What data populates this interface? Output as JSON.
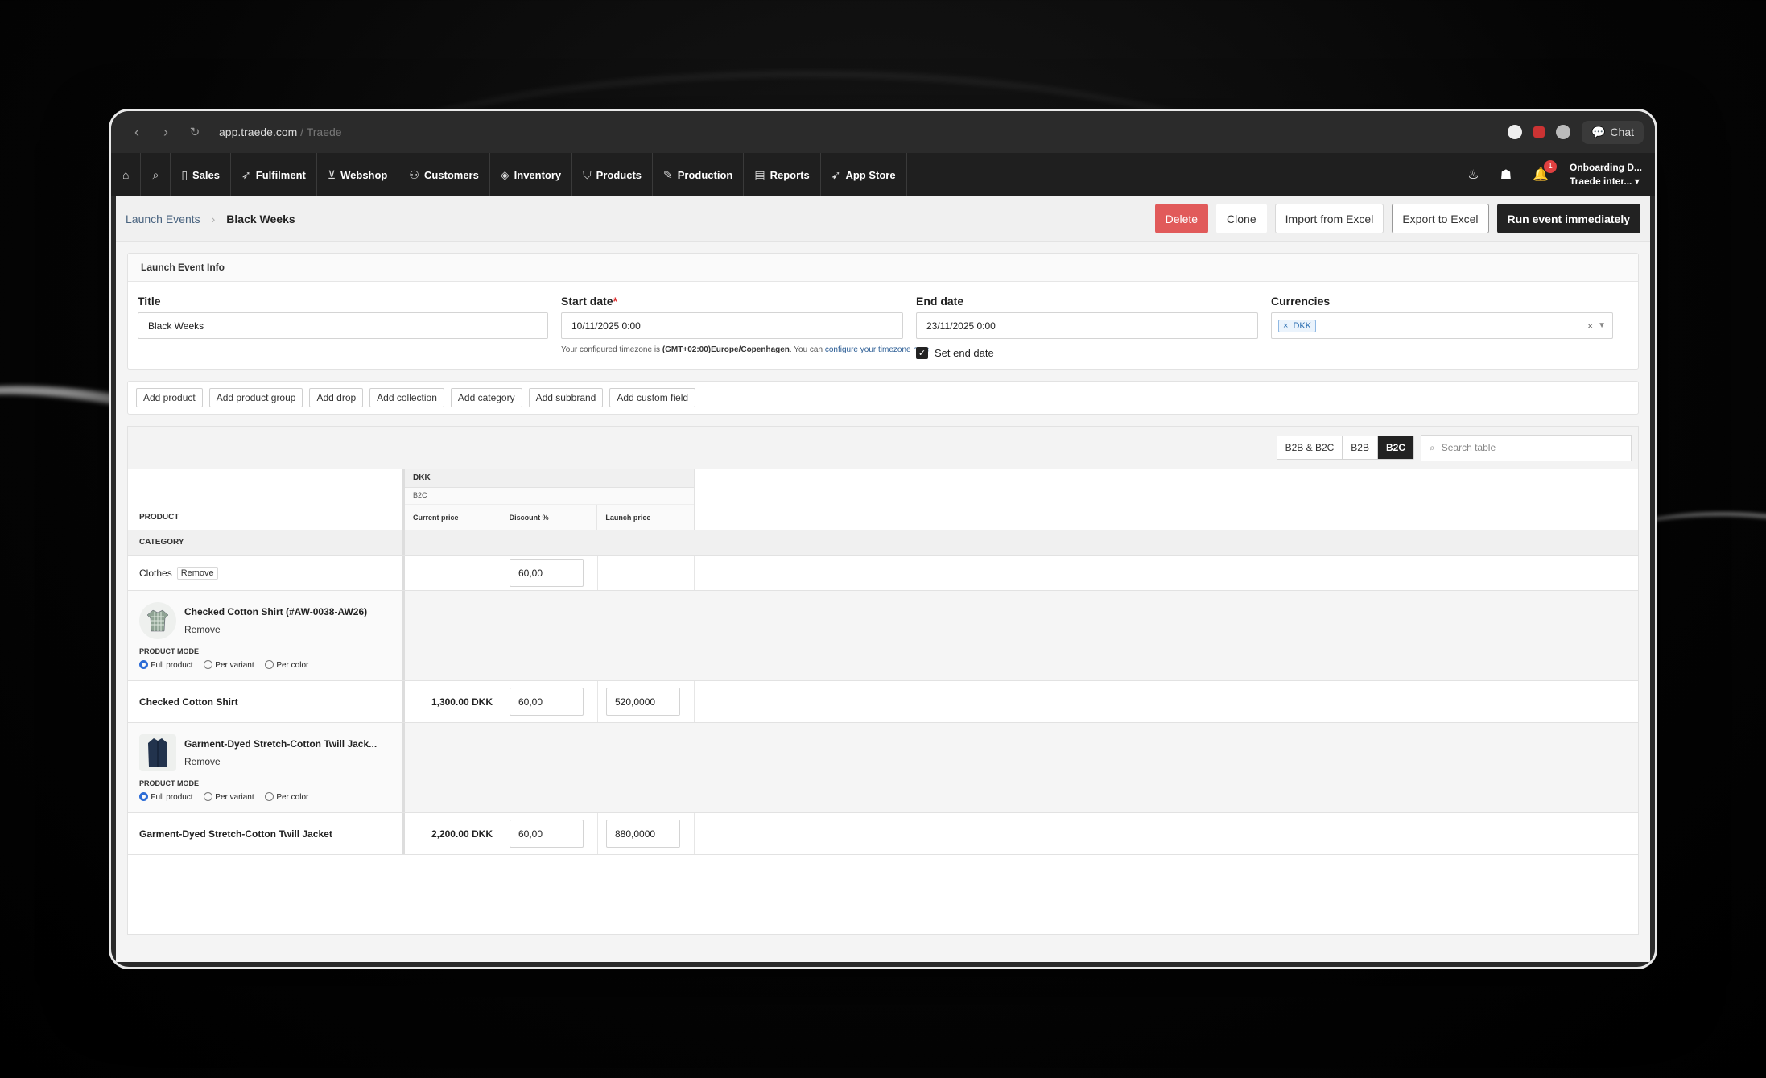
{
  "browser": {
    "url_host": "app.traede.com",
    "url_suffix": " / Traede",
    "chat_label": "Chat"
  },
  "nav": {
    "items": [
      {
        "label": "Sales",
        "icon": "document-icon"
      },
      {
        "label": "Fulfilment",
        "icon": "send-icon"
      },
      {
        "label": "Webshop",
        "icon": "cart-icon"
      },
      {
        "label": "Customers",
        "icon": "users-icon"
      },
      {
        "label": "Inventory",
        "icon": "box-icon"
      },
      {
        "label": "Products",
        "icon": "shirt-icon"
      },
      {
        "label": "Production",
        "icon": "pencil-icon"
      },
      {
        "label": "Reports",
        "icon": "chart-icon"
      },
      {
        "label": "App Store",
        "icon": "rocket-icon"
      }
    ],
    "notification_count": "1",
    "user_line1": "Onboarding D...",
    "user_line2": "Traede inter..."
  },
  "header": {
    "breadcrumb_parent": "Launch Events",
    "breadcrumb_current": "Black Weeks",
    "delete": "Delete",
    "clone": "Clone",
    "import": "Import from Excel",
    "export": "Export to Excel",
    "run": "Run event immediately"
  },
  "info": {
    "card_title": "Launch Event Info",
    "title_label": "Title",
    "title_value": "Black Weeks",
    "start_label": "Start date",
    "start_required": "*",
    "start_value": "10/11/2025 0:00",
    "end_label": "End date",
    "end_value": "23/11/2025 0:00",
    "set_end_label": "Set end date",
    "currencies_label": "Currencies",
    "currency_tag": "DKK",
    "tz_prefix": "Your configured timezone is ",
    "tz_value": "(GMT+02:00)Europe/Copenhagen",
    "tz_mid": ". You can ",
    "tz_link": "configure your timezone here"
  },
  "add_buttons": [
    "Add product",
    "Add product group",
    "Add drop",
    "Add collection",
    "Add category",
    "Add subbrand",
    "Add custom field"
  ],
  "table": {
    "segments": [
      "B2B & B2C",
      "B2B",
      "B2C"
    ],
    "active_segment": "B2C",
    "search_placeholder": "Search table",
    "currency_header": "DKK",
    "channel_header": "B2C",
    "col_product": "PRODUCT",
    "col_current": "Current price",
    "col_discount": "Discount %",
    "col_launch": "Launch price",
    "category_header": "CATEGORY",
    "category_row": {
      "name": "Clothes",
      "remove": "Remove",
      "discount": "60,00"
    },
    "product_mode_label": "PRODUCT MODE",
    "mode_options": [
      "Full product",
      "Per variant",
      "Per color"
    ],
    "products": [
      {
        "title": "Checked Cotton Shirt (#AW-0038-AW26)",
        "remove": "Remove",
        "row_name": "Checked Cotton Shirt",
        "current_price": "1,300.00 DKK",
        "discount": "60,00",
        "launch_price": "520,0000"
      },
      {
        "title": "Garment-Dyed Stretch-Cotton Twill Jack...",
        "remove": "Remove",
        "row_name": "Garment-Dyed Stretch-Cotton Twill Jacket",
        "current_price": "2,200.00 DKK",
        "discount": "60,00",
        "launch_price": "880,0000"
      }
    ]
  },
  "colors": {
    "danger": "#e15a5a",
    "dark": "#222222",
    "link": "#2a5c94",
    "tag": "#2a6db0"
  }
}
